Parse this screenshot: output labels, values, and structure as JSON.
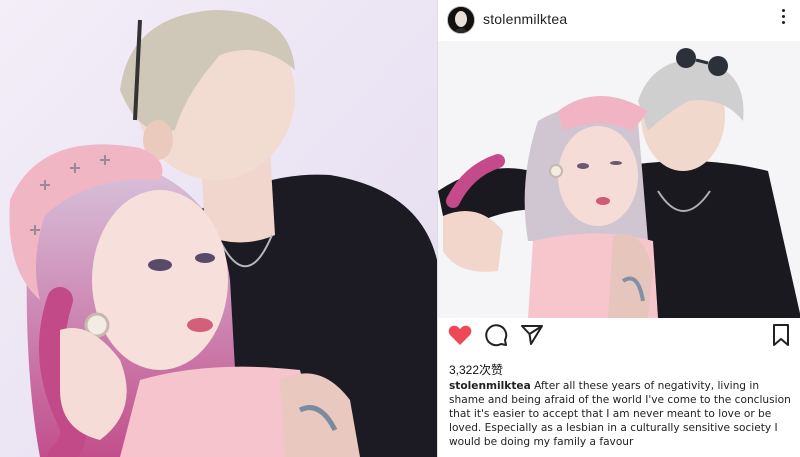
{
  "post": {
    "username": "stolenmilktea",
    "likes": "3,322次赞",
    "caption_user": "stolenmilktea",
    "caption_text": "After all these years of negativity, living in shame and being afraid of the world I've come to the conclusion that it's easier to accept that I am never meant to love or be loved. Especially as a lesbian in a culturally sensitive society I would be doing my family a favour"
  },
  "icons": {
    "like": "heart-icon",
    "comment": "comment-icon",
    "share": "send-icon",
    "save": "bookmark-icon",
    "more": "more-options-icon"
  },
  "colors": {
    "like_red": "#ed4956",
    "text": "#222222"
  }
}
